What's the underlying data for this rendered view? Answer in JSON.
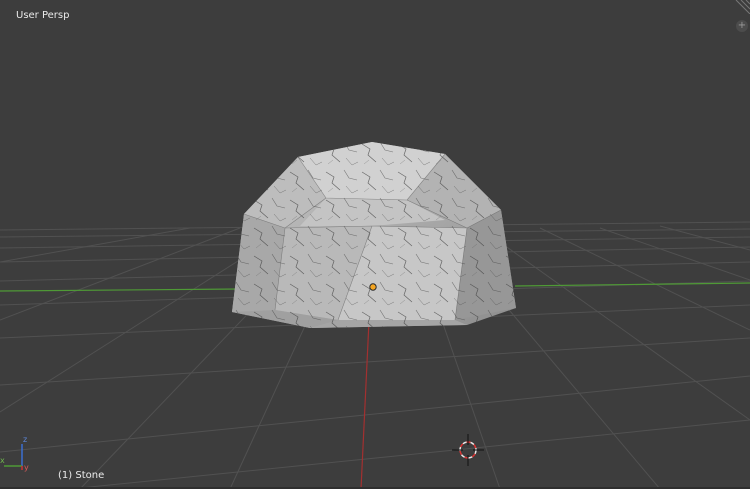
{
  "viewport": {
    "header_label": "User Persp",
    "object_label": "(1) Stone"
  },
  "colors": {
    "background": "#3d3d3d",
    "grid": "#4f4f4f",
    "x_axis": "#5a9a3a",
    "y_axis": "#a33030",
    "text": "#eaeaea",
    "origin": "#f5a623",
    "cursor": "#d33"
  },
  "icons": {
    "corner_widget": "split-corner-icon",
    "add_widget": "plus-icon",
    "axis_gizmo": "axis-gizmo-icon",
    "cursor_3d": "3d-cursor-icon",
    "object_origin": "origin-dot-icon"
  },
  "add_widget_glyph": "+"
}
